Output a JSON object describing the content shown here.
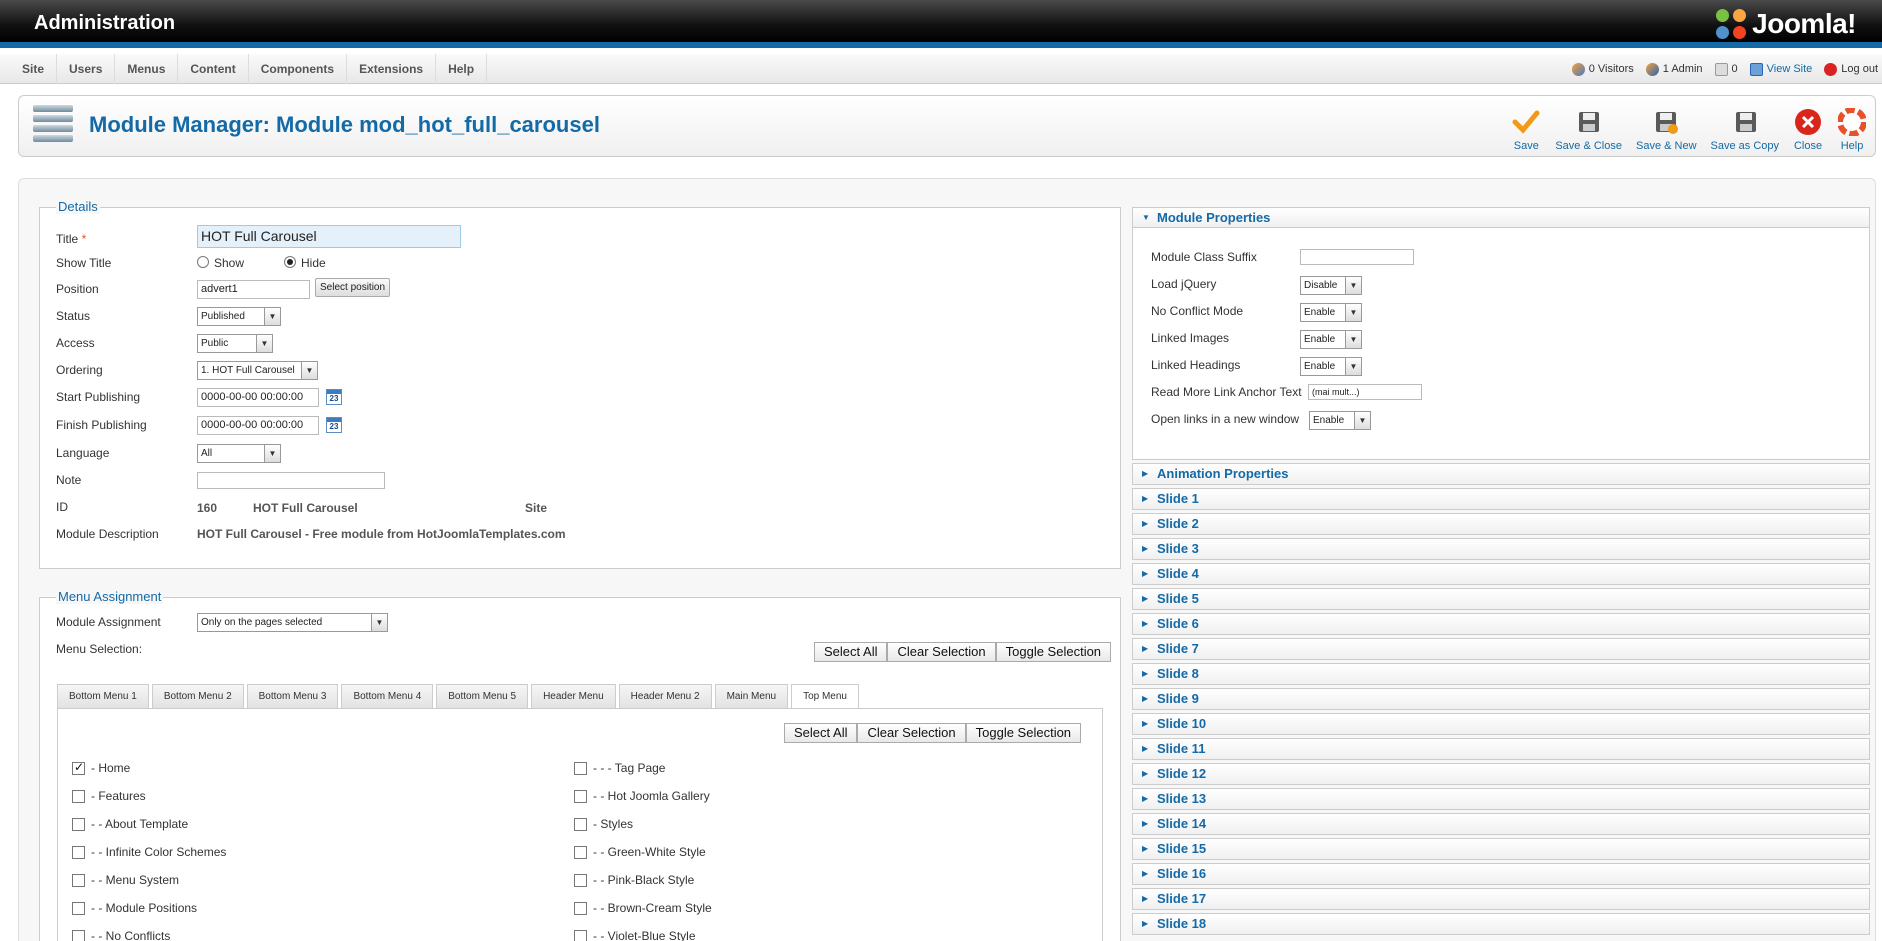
{
  "header": {
    "app_title": "Administration",
    "brand": "Joomla!"
  },
  "menu": [
    "Site",
    "Users",
    "Menus",
    "Content",
    "Components",
    "Extensions",
    "Help"
  ],
  "status": {
    "visitors": "0 Visitors",
    "admins": "1 Admin",
    "messages": "0",
    "view_site": "View Site",
    "logout": "Log out"
  },
  "page": {
    "title": "Module Manager: Module mod_hot_full_carousel"
  },
  "toolbar": {
    "save": "Save",
    "save_close": "Save & Close",
    "save_new": "Save & New",
    "save_copy": "Save as Copy",
    "close": "Close",
    "help": "Help"
  },
  "details": {
    "legend": "Details",
    "title_label": "Title",
    "title_value": "HOT Full Carousel",
    "show_title_label": "Show Title",
    "show_option": "Show",
    "hide_option": "Hide",
    "show_title_selected": "Hide",
    "position_label": "Position",
    "position_value": "advert1",
    "select_position": "Select position",
    "status_label": "Status",
    "status_value": "Published",
    "access_label": "Access",
    "access_value": "Public",
    "ordering_label": "Ordering",
    "ordering_value": "1. HOT Full Carousel",
    "start_label": "Start Publishing",
    "start_value": "0000-00-00 00:00:00",
    "finish_label": "Finish Publishing",
    "finish_value": "0000-00-00 00:00:00",
    "language_label": "Language",
    "language_value": "All",
    "note_label": "Note",
    "note_value": "",
    "id_label": "ID",
    "id_value": "160",
    "id_name": "HOT Full Carousel",
    "id_client": "Site",
    "desc_label": "Module Description",
    "desc_value": "HOT Full Carousel - Free module from HotJoomlaTemplates.com"
  },
  "assignment": {
    "legend": "Menu Assignment",
    "label": "Module Assignment",
    "value": "Only on the pages selected",
    "menu_selection_label": "Menu Selection:",
    "select_all": "Select All",
    "clear_selection": "Clear Selection",
    "toggle_selection": "Toggle Selection",
    "tabs": [
      "Bottom Menu 1",
      "Bottom Menu 2",
      "Bottom Menu 3",
      "Bottom Menu 4",
      "Bottom Menu 5",
      "Header Menu",
      "Header Menu 2",
      "Main Menu",
      "Top Menu"
    ],
    "active_tab": "Top Menu",
    "items_left": [
      {
        "label": "- Home",
        "checked": true
      },
      {
        "label": "- Features",
        "checked": false
      },
      {
        "label": "- - About Template",
        "checked": false
      },
      {
        "label": "- - Infinite Color Schemes",
        "checked": false
      },
      {
        "label": "- - Menu System",
        "checked": false
      },
      {
        "label": "- - Module Positions",
        "checked": false
      },
      {
        "label": "- - No Conflicts",
        "checked": false
      }
    ],
    "items_right": [
      {
        "label": "- - - Tag Page",
        "checked": false
      },
      {
        "label": "- - Hot Joomla Gallery",
        "checked": false
      },
      {
        "label": "- Styles",
        "checked": false
      },
      {
        "label": "- - Green-White Style",
        "checked": false
      },
      {
        "label": "- - Pink-Black Style",
        "checked": false
      },
      {
        "label": "- - Brown-Cream Style",
        "checked": false
      },
      {
        "label": "- - Violet-Blue Style",
        "checked": false
      }
    ]
  },
  "properties": {
    "heading": "Module Properties",
    "class_suffix_label": "Module Class Suffix",
    "class_suffix_value": "",
    "jquery_label": "Load jQuery",
    "jquery_value": "Disable",
    "noconflict_label": "No Conflict Mode",
    "noconflict_value": "Enable",
    "linked_images_label": "Linked Images",
    "linked_images_value": "Enable",
    "linked_headings_label": "Linked Headings",
    "linked_headings_value": "Enable",
    "readmore_label": "Read More Link Anchor Text",
    "readmore_value": "(mai mult...)",
    "newwindow_label": "Open links in a new window",
    "newwindow_value": "Enable"
  },
  "accordion": [
    "Animation Properties",
    "Slide 1",
    "Slide 2",
    "Slide 3",
    "Slide 4",
    "Slide 5",
    "Slide 6",
    "Slide 7",
    "Slide 8",
    "Slide 9",
    "Slide 10",
    "Slide 11",
    "Slide 12",
    "Slide 13",
    "Slide 14",
    "Slide 15",
    "Slide 16",
    "Slide 17",
    "Slide 18"
  ],
  "colors": {
    "accent": "#146aa6",
    "header_bg": "#111111",
    "required": "#e8522b"
  }
}
